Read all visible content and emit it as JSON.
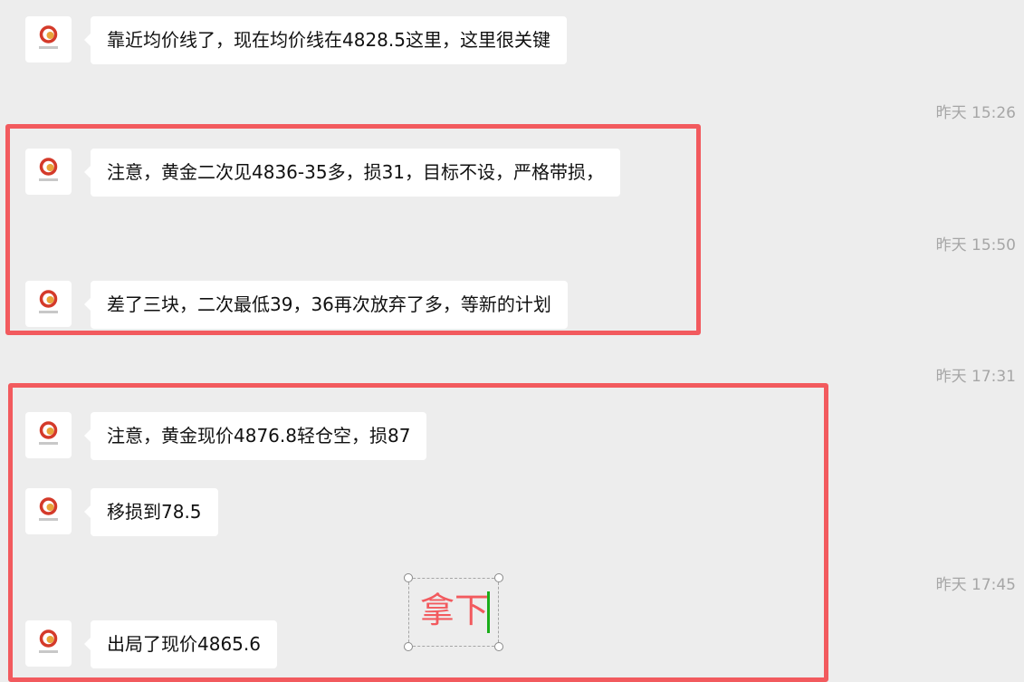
{
  "colors": {
    "background": "#ededed",
    "bubble": "#ffffff",
    "highlight": "#f25a5e",
    "annotation_text": "#f25a5e",
    "caret": "#1aad19",
    "timestamp": "#a6a6a6"
  },
  "messages": [
    {
      "text": "靠近均价线了，现在均价线在4828.5这里，这里很关键"
    },
    {
      "text": "注意，黄金二次见4836-35多，损31，目标不设，严格带损，"
    },
    {
      "text": "差了三块，二次最低39，36再次放弃了多，等新的计划"
    },
    {
      "text": "注意，黄金现价4876.8轻仓空，损87"
    },
    {
      "text": "移损到78.5"
    },
    {
      "text": "出局了现价4865.6"
    }
  ],
  "timestamps": [
    {
      "text": "昨天 15:26"
    },
    {
      "text": "昨天 15:50"
    },
    {
      "text": "昨天 17:31"
    },
    {
      "text": "昨天 17:45"
    }
  ],
  "annotation": {
    "text": "拿下"
  },
  "avatar_icon": "company-logo-icon"
}
